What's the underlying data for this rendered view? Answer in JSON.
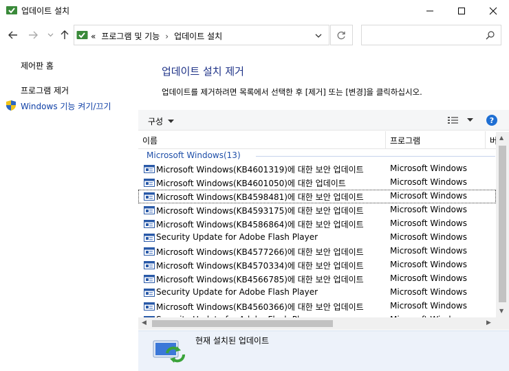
{
  "window": {
    "title": "업데이트 설치",
    "controls": {
      "minimize": "minimize-icon",
      "maximize": "maximize-icon",
      "close": "close-icon"
    },
    "app_icon": "programs-updates-icon"
  },
  "nav": {
    "back_icon": "arrow-left-icon",
    "forward_icon": "arrow-right-icon",
    "recent_icon": "chevron-down-icon",
    "up_icon": "arrow-up-icon",
    "address": {
      "overflow": "«",
      "crumbs": [
        "프로그램 및 기능",
        "업데이트 설치"
      ],
      "separator": "›"
    },
    "refresh_icon": "refresh-icon",
    "search": {
      "placeholder": "",
      "icon": "search-icon"
    }
  },
  "sidebar": {
    "items": [
      {
        "label": "제어판 홈"
      },
      {
        "label": "프로그램 제거"
      },
      {
        "label": "Windows 기능 켜기/끄기",
        "icon": "shield-icon"
      }
    ]
  },
  "main": {
    "heading": "업데이트 설치 제거",
    "description": "업데이트를 제거하려면 목록에서 선택한 후 [제거] 또는 [변경]을 클릭하십시오."
  },
  "toolbar": {
    "organize_label": "구성",
    "view_icon": "view-details-icon",
    "help_label": "?"
  },
  "table": {
    "columns": [
      "이름",
      "프로그램",
      "버"
    ],
    "group": "Microsoft Windows(13)",
    "rows": [
      {
        "name": "Microsoft Windows(KB4601319)에 대한 보안 업데이트",
        "program": "Microsoft Windows",
        "selected": false
      },
      {
        "name": "Microsoft Windows(KB4601050)에 대한 업데이트",
        "program": "Microsoft Windows",
        "selected": false
      },
      {
        "name": "Microsoft Windows(KB4598481)에 대한 보안 업데이트",
        "program": "Microsoft Windows",
        "selected": true
      },
      {
        "name": "Microsoft Windows(KB4593175)에 대한 보안 업데이트",
        "program": "Microsoft Windows",
        "selected": false
      },
      {
        "name": "Microsoft Windows(KB4586864)에 대한 보안 업데이트",
        "program": "Microsoft Windows",
        "selected": false
      },
      {
        "name": "Security Update for Adobe Flash Player",
        "program": "Microsoft Windows",
        "selected": false
      },
      {
        "name": "Microsoft Windows(KB4577266)에 대한 보안 업데이트",
        "program": "Microsoft Windows",
        "selected": false
      },
      {
        "name": "Microsoft Windows(KB4570334)에 대한 보안 업데이트",
        "program": "Microsoft Windows",
        "selected": false
      },
      {
        "name": "Microsoft Windows(KB4566785)에 대한 보안 업데이트",
        "program": "Microsoft Windows",
        "selected": false
      },
      {
        "name": "Security Update for Adobe Flash Player",
        "program": "Microsoft Windows",
        "selected": false
      },
      {
        "name": "Microsoft Windows(KB4560366)에 대한 보안 업데이트",
        "program": "Microsoft Windows",
        "selected": false
      },
      {
        "name": "Security Update for Adobe Flash Player",
        "program": "Microsoft Windows",
        "selected": false
      }
    ]
  },
  "details": {
    "label": "현재 설치된 업데이트",
    "icon": "installed-updates-icon"
  },
  "colors": {
    "heading": "#1e3287",
    "link_blue": "#0d3ea5",
    "group_blue": "#1e4ea8",
    "details_bg": "#edf2fa"
  }
}
